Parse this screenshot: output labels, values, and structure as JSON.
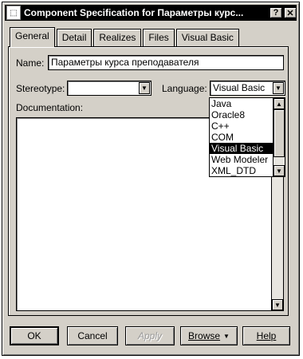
{
  "window": {
    "title": "Component Specification for Параметры курс...",
    "help_glyph": "?",
    "close_glyph": "✕",
    "icon": "component-icon"
  },
  "tabs": [
    {
      "label": "General",
      "active": true
    },
    {
      "label": "Detail"
    },
    {
      "label": "Realizes"
    },
    {
      "label": "Files"
    },
    {
      "label": "Visual Basic"
    }
  ],
  "form": {
    "name_label": "Name:",
    "name_value": "Параметры курса преподавателя",
    "stereotype_label": "Stereotype:",
    "stereotype_value": "",
    "language_label": "Language:",
    "language_value": "Visual Basic",
    "documentation_label": "Documentation:",
    "documentation_value": ""
  },
  "language_options": [
    "Java",
    "Oracle8",
    "C++",
    "COM",
    "Visual Basic",
    "Web Modeler",
    "XML_DTD"
  ],
  "language_selected": "Visual Basic",
  "buttons": {
    "ok": "OK",
    "cancel": "Cancel",
    "apply": "Apply",
    "browse": "Browse",
    "help": "Help"
  },
  "glyphs": {
    "down_arrow": "▼",
    "up_arrow": "▲"
  }
}
